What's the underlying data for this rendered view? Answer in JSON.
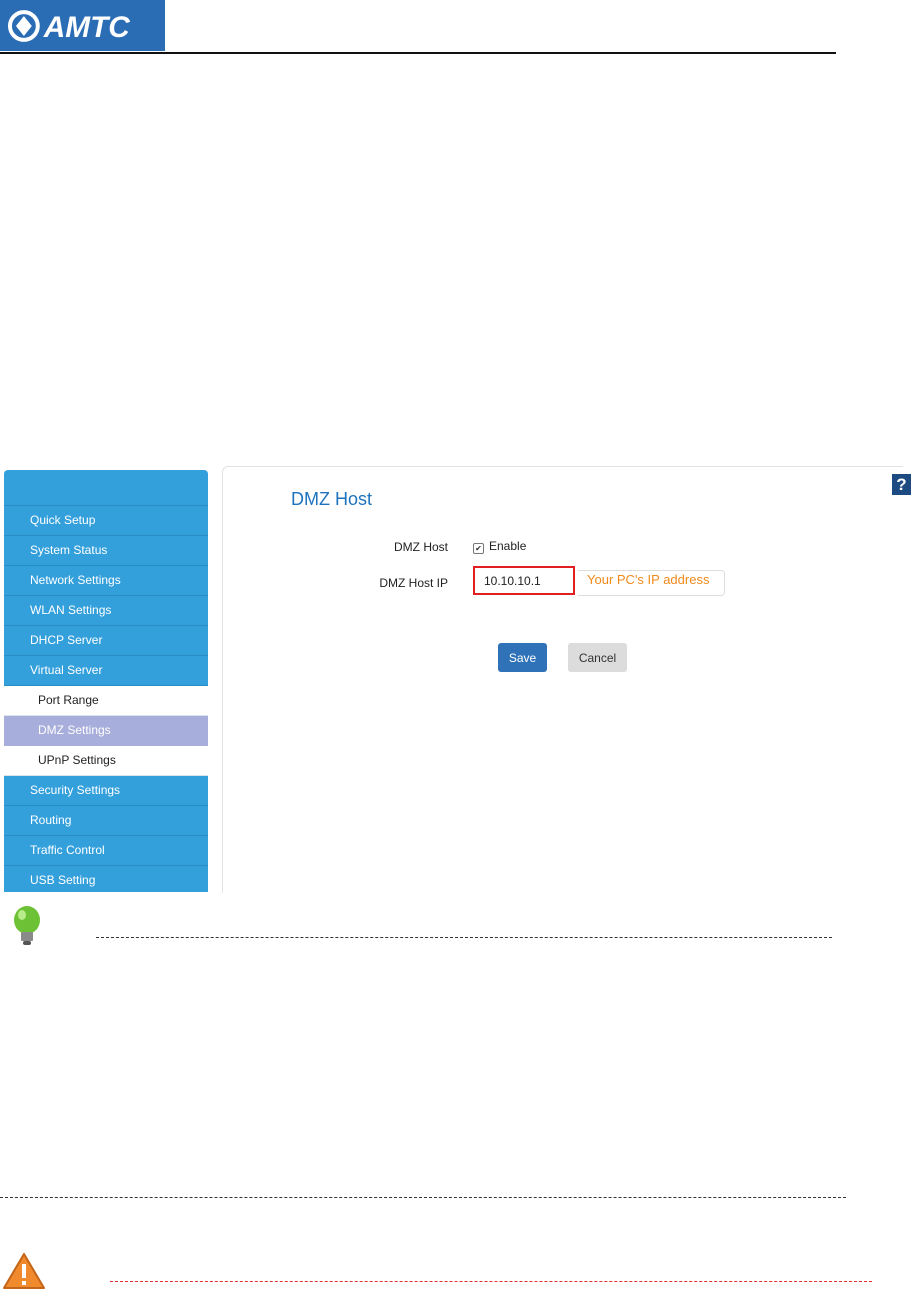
{
  "brand": {
    "logo_text": "AMTC",
    "color": "#2a6db5"
  },
  "sidebar": {
    "items": [
      {
        "label": "Quick Setup",
        "type": "main"
      },
      {
        "label": "System Status",
        "type": "main"
      },
      {
        "label": "Network Settings",
        "type": "main"
      },
      {
        "label": "WLAN Settings",
        "type": "main"
      },
      {
        "label": "DHCP Server",
        "type": "main"
      },
      {
        "label": "Virtual Server",
        "type": "main"
      },
      {
        "label": "Port Range",
        "type": "sub"
      },
      {
        "label": "DMZ Settings",
        "type": "sub",
        "active": true
      },
      {
        "label": "UPnP Settings",
        "type": "sub"
      },
      {
        "label": "Security Settings",
        "type": "main"
      },
      {
        "label": "Routing",
        "type": "main"
      },
      {
        "label": "Traffic Control",
        "type": "main"
      },
      {
        "label": "USB Setting",
        "type": "main"
      }
    ]
  },
  "main": {
    "title": "DMZ Host",
    "dmz_host_label": "DMZ Host",
    "enable_label": "Enable",
    "enable_checked": true,
    "ip_label": "DMZ Host IP",
    "ip_value": "10.10.10.1",
    "ip_hint": "Your PC's IP address",
    "save_label": "Save",
    "cancel_label": "Cancel",
    "help_icon": "?"
  },
  "colors": {
    "sidebar": "#33a0dc",
    "active_sub": "#a8aedb",
    "title": "#1e73be",
    "highlight_border": "#e02020",
    "hint_text": "#f08a1c",
    "save_button": "#2f72b8"
  },
  "icons": [
    "lightbulb-icon",
    "warning-icon",
    "help-icon",
    "checkbox-check-icon"
  ]
}
